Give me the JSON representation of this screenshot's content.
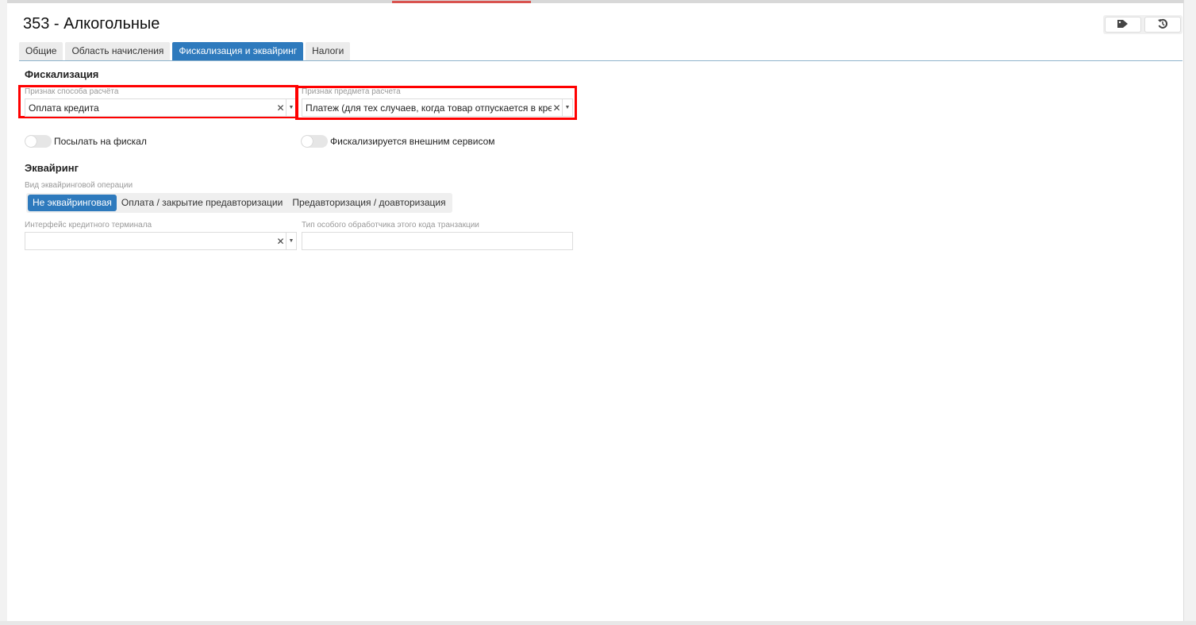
{
  "title": "353 - Алкогольные",
  "header_buttons": [
    {
      "icon": "tag-icon"
    },
    {
      "icon": "history-icon"
    }
  ],
  "tabs": [
    {
      "label": "Общие"
    },
    {
      "label": "Область начисления"
    },
    {
      "label": "Фискализация и эквайринг",
      "active": true
    },
    {
      "label": "Налоги"
    }
  ],
  "fiscal": {
    "heading": "Фискализация",
    "payment_method": {
      "label": "Признак способа расчёта",
      "value": "Оплата кредита"
    },
    "payment_subject": {
      "label": "Признак предмета расчета",
      "value": "Платеж (для тех случаев, когда товар отпускается в кредит)"
    },
    "send_to_fiscal": {
      "label": "Посылать на фискал",
      "on": false
    },
    "external_service": {
      "label": "Фискализируется внешним сервисом",
      "on": false
    }
  },
  "acquiring": {
    "heading": "Эквайринг",
    "op_type_label": "Вид эквайринговой операции",
    "op_types": [
      {
        "label": "Не эквайринговая",
        "active": true
      },
      {
        "label": "Оплата / закрытие предавторизации"
      },
      {
        "label": "Предавторизация / доавторизация"
      }
    ],
    "terminal": {
      "label": "Интерфейс кредитного терминала",
      "value": ""
    },
    "handler": {
      "label": "Тип особого обработчика этого кода транзакции",
      "value": ""
    }
  },
  "colors": {
    "accent": "#2e7abd",
    "highlight": "#ff0000"
  }
}
